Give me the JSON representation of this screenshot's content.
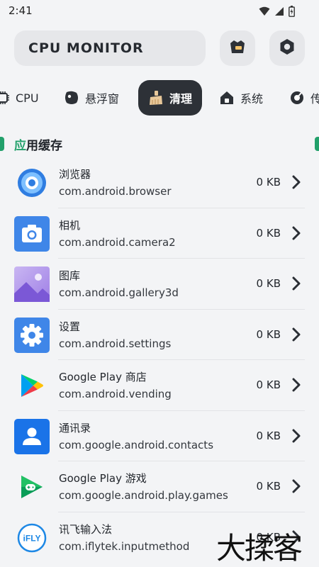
{
  "status_bar": {
    "time": "2:41",
    "icons": [
      "wifi-icon",
      "signal-icon",
      "battery-icon"
    ]
  },
  "header": {
    "title": "CPU MONITOR",
    "buttons": [
      "theme-icon",
      "settings-icon"
    ]
  },
  "tabs": [
    {
      "label": "CPU",
      "icon": "cpu-icon",
      "active": false
    },
    {
      "label": "悬浮窗",
      "icon": "floating-window-icon",
      "active": false
    },
    {
      "label": "清理",
      "icon": "broom-icon",
      "active": true
    },
    {
      "label": "系统",
      "icon": "house-icon",
      "active": false
    },
    {
      "label": "传",
      "icon": "sensor-icon",
      "active": false
    }
  ],
  "section": {
    "title_accent": "应",
    "title_rest": "用缓存"
  },
  "apps": [
    {
      "name": "浏览器",
      "package": "com.android.browser",
      "size": "0 KB",
      "icon": "browser-icon"
    },
    {
      "name": "相机",
      "package": "com.android.camera2",
      "size": "0 KB",
      "icon": "camera-icon"
    },
    {
      "name": "图库",
      "package": "com.android.gallery3d",
      "size": "0 KB",
      "icon": "gallery-icon"
    },
    {
      "name": "设置",
      "package": "com.android.settings",
      "size": "0 KB",
      "icon": "settings-gear-icon"
    },
    {
      "name": "Google Play 商店",
      "package": "com.android.vending",
      "size": "0 KB",
      "icon": "play-store-icon"
    },
    {
      "name": "通讯录",
      "package": "com.google.android.contacts",
      "size": "0 KB",
      "icon": "contacts-icon"
    },
    {
      "name": "Google Play 游戏",
      "package": "com.google.android.play.games",
      "size": "0 KB",
      "icon": "play-games-icon"
    },
    {
      "name": "讯飞输入法",
      "package": "com.iflytek.inputmethod",
      "size": "0 KB",
      "icon": "ifly-icon",
      "icon_text": "iFLY"
    }
  ],
  "watermark": "大揉客",
  "colors": {
    "accent": "#22a06b",
    "active_tab": "#2d3137",
    "background": "#f3f4f6"
  }
}
